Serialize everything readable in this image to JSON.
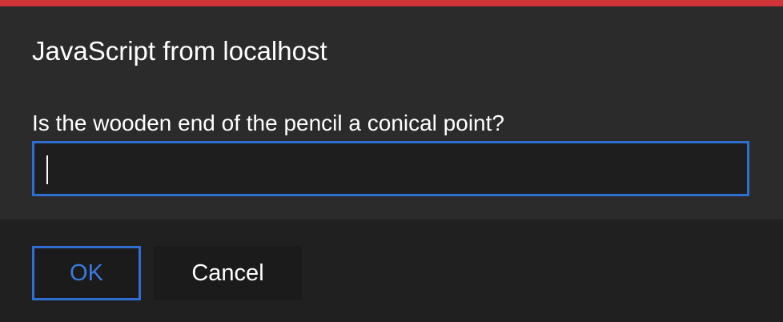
{
  "dialog": {
    "title": "JavaScript from localhost",
    "message": "Is the wooden end of the pencil a conical point?",
    "input": {
      "value": "",
      "placeholder": ""
    },
    "buttons": {
      "ok_label": "OK",
      "cancel_label": "Cancel"
    },
    "colors": {
      "accent_bar": "#d13438",
      "focus_blue": "#2f6fd1",
      "background": "#2b2b2c",
      "footer": "#202020"
    }
  }
}
